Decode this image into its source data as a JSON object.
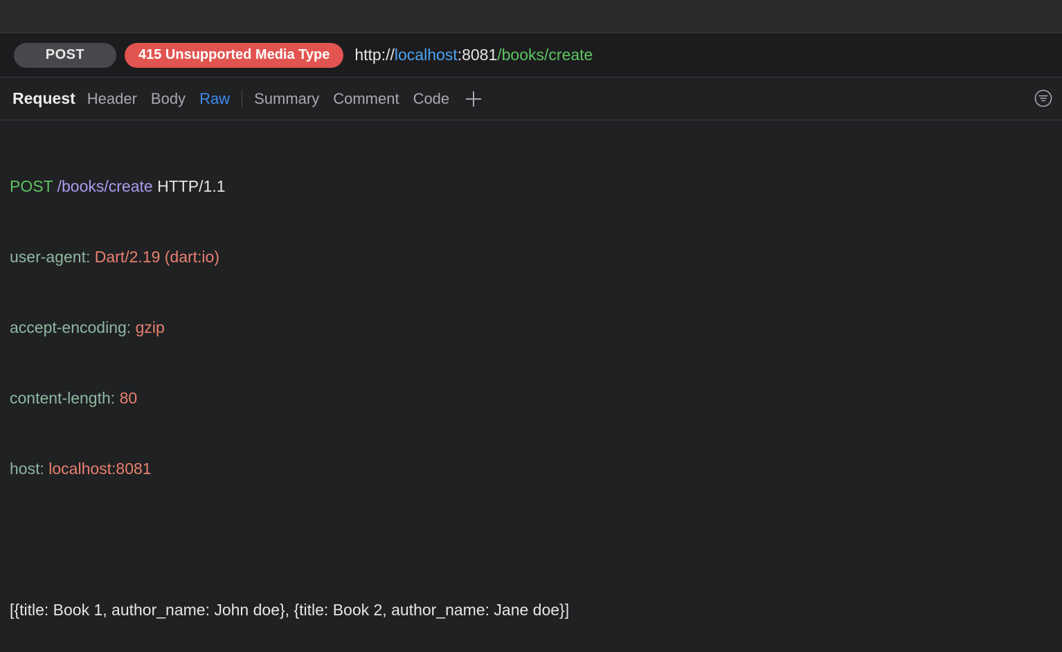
{
  "request_line": {
    "method": "POST",
    "status": "415 Unsupported Media Type",
    "url_scheme": "http://",
    "url_host": "localhost",
    "url_port": ":8081",
    "url_path": "/books/create"
  },
  "tabs": {
    "title": "Request",
    "items": [
      {
        "label": "Header",
        "active": false
      },
      {
        "label": "Body",
        "active": false
      },
      {
        "label": "Raw",
        "active": true
      },
      {
        "label": "Summary",
        "active": false
      },
      {
        "label": "Comment",
        "active": false
      },
      {
        "label": "Code",
        "active": false
      }
    ],
    "add_icon": "plus-icon",
    "filter_icon": "filter-icon"
  },
  "raw": {
    "method": "POST",
    "path": "/books/create",
    "protocol": "HTTP/1.1",
    "headers": [
      {
        "name": "user-agent:",
        "value": "Dart/2.19 (dart:io)"
      },
      {
        "name": "accept-encoding:",
        "value": "gzip"
      },
      {
        "name": "content-length:",
        "value": "80"
      },
      {
        "name": "host:",
        "value": "localhost:8081"
      }
    ],
    "body": "[{title: Book 1, author_name: John doe}, {title: Book 2, author_name: Jane doe}]"
  },
  "colors": {
    "background": "#202123",
    "status_error": "#e2544f",
    "accent_blue": "#3d8cf3",
    "green": "#5dc461",
    "header_name": "#8fb8a0",
    "header_value": "#e8806f"
  }
}
